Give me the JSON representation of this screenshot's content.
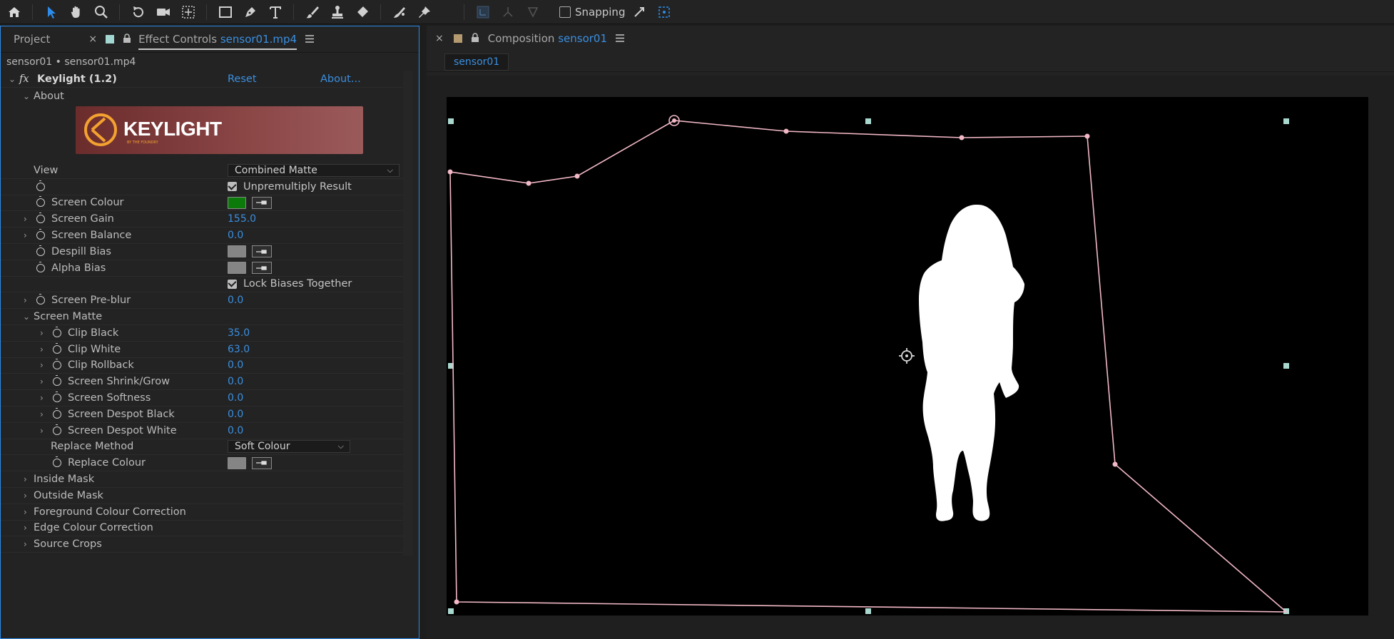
{
  "toolbar": {
    "tools": [
      "home-icon",
      "selection-icon",
      "hand-icon",
      "zoom-icon",
      "rotate-icon",
      "camera-icon",
      "pan-behind-icon",
      "rectangle-icon",
      "pen-icon",
      "type-icon",
      "brush-icon",
      "clone-stamp-icon",
      "eraser-icon",
      "roto-brush-icon",
      "puppet-pin-icon"
    ],
    "snapping_label": "Snapping"
  },
  "project_tab": {
    "label": "Project"
  },
  "effect_controls_tab": {
    "prefix": "Effect Controls",
    "file": "sensor01.mp4"
  },
  "layer_path": "sensor01 • sensor01.mp4",
  "effect": {
    "fx": "fx",
    "name": "Keylight (1.2)",
    "reset": "Reset",
    "about_link": "About...",
    "about_section": "About",
    "logo_text": "KEYLIGHT",
    "logo_subtext": "BY THE FOUNDRY"
  },
  "params": {
    "view": {
      "label": "View",
      "value": "Combined Matte"
    },
    "unpremultiply": {
      "label": "Unpremultiply Result"
    },
    "screen_colour": {
      "label": "Screen Colour",
      "color": "#0b7a0b"
    },
    "screen_gain": {
      "label": "Screen Gain",
      "value": "155.0"
    },
    "screen_balance": {
      "label": "Screen Balance",
      "value": "0.0"
    },
    "despill_bias": {
      "label": "Despill Bias",
      "color": "#858585"
    },
    "alpha_bias": {
      "label": "Alpha Bias",
      "color": "#858585"
    },
    "lock_biases": {
      "label": "Lock Biases Together"
    },
    "screen_preblur": {
      "label": "Screen Pre-blur",
      "value": "0.0"
    },
    "screen_matte": {
      "label": "Screen Matte"
    },
    "clip_black": {
      "label": "Clip Black",
      "value": "35.0"
    },
    "clip_white": {
      "label": "Clip White",
      "value": "63.0"
    },
    "clip_rollback": {
      "label": "Clip Rollback",
      "value": "0.0"
    },
    "screen_shrink": {
      "label": "Screen Shrink/Grow",
      "value": "0.0"
    },
    "screen_softness": {
      "label": "Screen Softness",
      "value": "0.0"
    },
    "despot_black": {
      "label": "Screen Despot Black",
      "value": "0.0"
    },
    "despot_white": {
      "label": "Screen Despot White",
      "value": "0.0"
    },
    "replace_method": {
      "label": "Replace Method",
      "value": "Soft Colour"
    },
    "replace_colour": {
      "label": "Replace Colour",
      "color": "#858585"
    },
    "inside_mask": {
      "label": "Inside Mask"
    },
    "outside_mask": {
      "label": "Outside Mask"
    },
    "fg_colour_correction": {
      "label": "Foreground Colour Correction"
    },
    "edge_colour_correction": {
      "label": "Edge Colour Correction"
    },
    "source_crops": {
      "label": "Source Crops"
    }
  },
  "composition_tab": {
    "prefix": "Composition",
    "name": "sensor01"
  },
  "comp_breadcrumb": "sensor01",
  "colors": {
    "accent_blue": "#3a8fe0",
    "mask_path": "#f2b8c6",
    "handle": "#a9d8cf",
    "panel_bg": "#232323",
    "canvas_bg": "#000000"
  }
}
